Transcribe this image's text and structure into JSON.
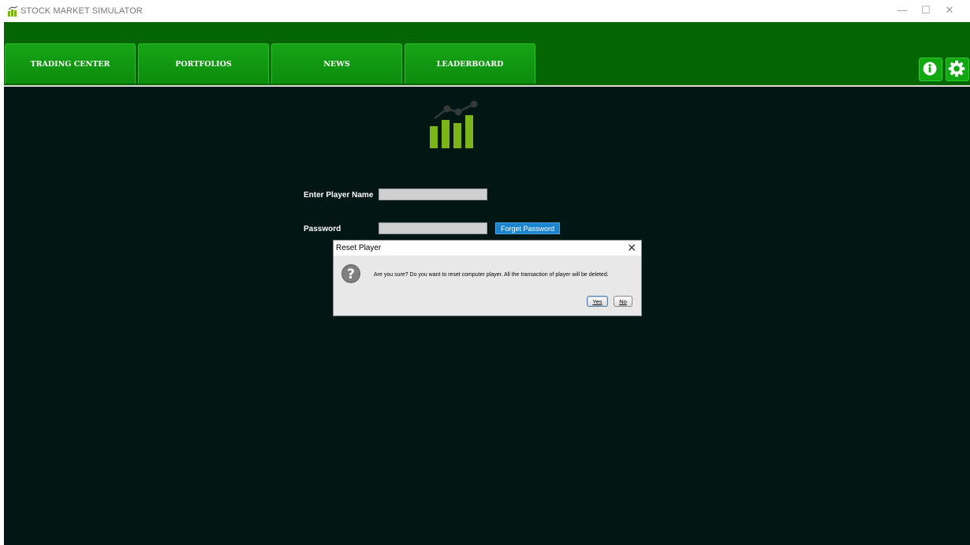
{
  "window": {
    "title": "STOCK MARKET SIMULATOR",
    "controls": {
      "minimize": "—",
      "maximize": "☐",
      "close": "✕"
    }
  },
  "nav": {
    "tabs": [
      {
        "label": "TRADING CENTER"
      },
      {
        "label": "PORTFOLIOS"
      },
      {
        "label": "NEWS"
      },
      {
        "label": "LEADERBOARD"
      }
    ],
    "right_buttons": [
      {
        "icon": "info-icon"
      },
      {
        "icon": "gear-icon"
      }
    ]
  },
  "login": {
    "player_name_label": "Enter Player Name",
    "player_name_value": "",
    "password_label": "Password",
    "password_value": "",
    "forget_password_label": "Forget Password"
  },
  "dialog": {
    "title": "Reset Player",
    "close": "✕",
    "message": "Are you sure? Do you want to reset computer player. All the transaction of player will be deleted.",
    "yes_label": "Yes",
    "no_label": "No"
  },
  "colors": {
    "background": "#021614",
    "nav_bar": "#036603",
    "tab": "#12a012",
    "logo_green": "#7cb518",
    "link_button": "#1b84cf"
  }
}
